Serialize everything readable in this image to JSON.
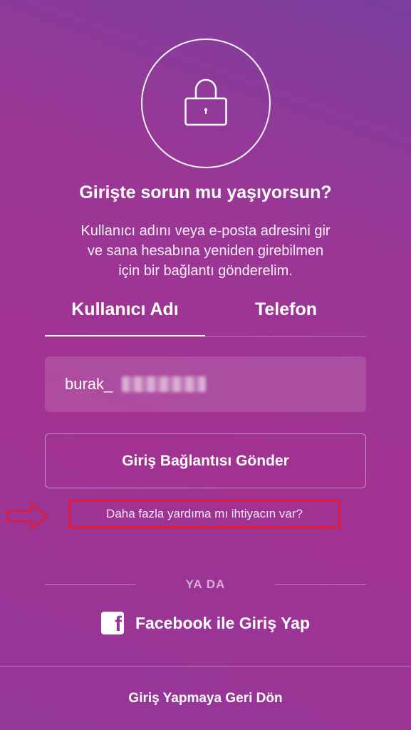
{
  "header": {
    "icon": "lock-icon",
    "title": "Girişte sorun mu yaşıyorsun?",
    "subtitle_lines": [
      "Kullanıcı adını veya e-posta adresini gir",
      "ve sana hesabına yeniden girebilmen",
      "için bir bağlantı gönderelim."
    ]
  },
  "tabs": {
    "username_label": "Kullanıcı Adı",
    "phone_label": "Telefon",
    "active": "username"
  },
  "form": {
    "username_value": "burak_"
  },
  "actions": {
    "send_link_label": "Giriş Bağlantısı Gönder",
    "help_label": "Daha fazla yardıma mı ihtiyacın var?"
  },
  "divider": {
    "or_label": "YA DA"
  },
  "facebook": {
    "icon": "facebook-icon",
    "label": "Facebook ile Giriş Yap"
  },
  "footer": {
    "back_label": "Giriş Yapmaya Geri Dön"
  },
  "annotation": {
    "highlight_color": "#e01b3c",
    "arrow_icon": "arrow-right-icon"
  }
}
